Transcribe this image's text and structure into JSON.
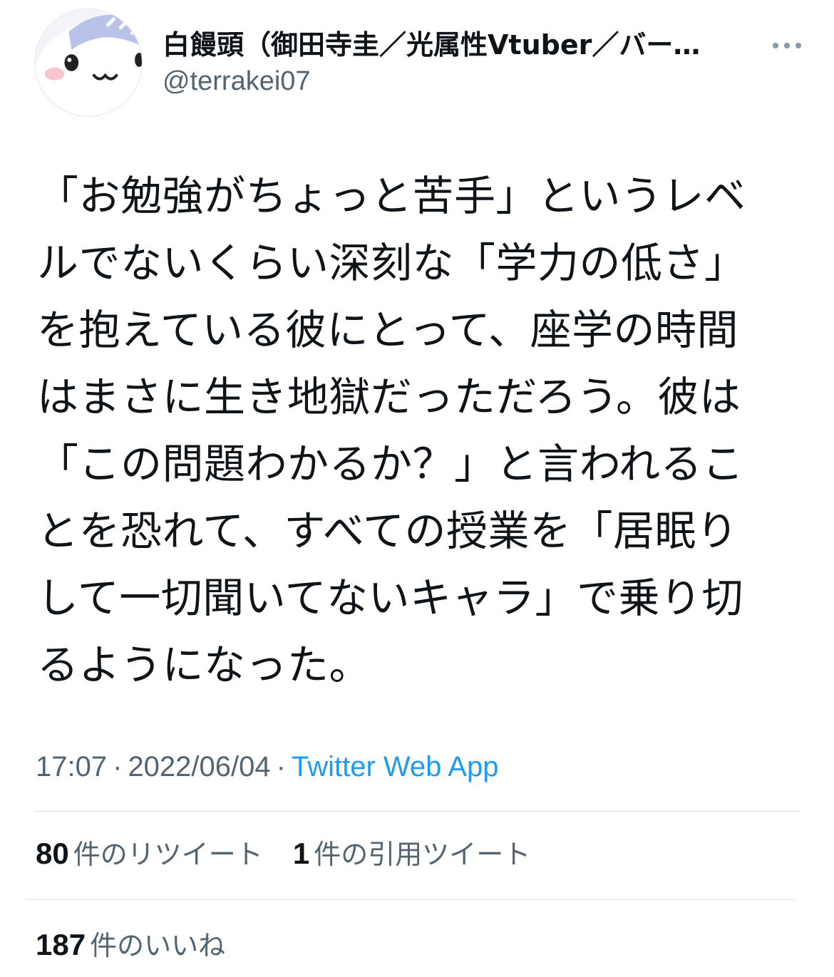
{
  "author": {
    "display_name": "白饅頭（御田寺圭／光属性Vtuber／バー…",
    "handle": "@terrakei07",
    "avatar_icon": "mascot-avatar-icon"
  },
  "tweet": {
    "lines": [
      "「お勉強がちょっと苦手」というレベ",
      "ルでないくらい深刻な「学力の低さ」",
      "を抱えている彼にとって、座学の時間",
      "はまさに生き地獄だっただろう。彼は",
      "「この問題わかるか？」と言われるこ",
      "とを恐れて、すべての授業を「居眠り",
      "して一切聞いてないキャラ」で乗り切",
      "るようになった。"
    ]
  },
  "meta": {
    "time": "17:07",
    "separator": "·",
    "date": "2022/06/04",
    "source": "Twitter Web App"
  },
  "stats": {
    "retweets_count": "80",
    "retweets_label": "件のリツイート",
    "quotes_count": "1",
    "quotes_label": "件の引用ツイート",
    "likes_count": "187",
    "likes_label": "件のいいね"
  },
  "colors": {
    "text": "#0f1419",
    "secondary": "#536471",
    "link": "#1d9bf0",
    "divider": "#d7dbdf"
  }
}
